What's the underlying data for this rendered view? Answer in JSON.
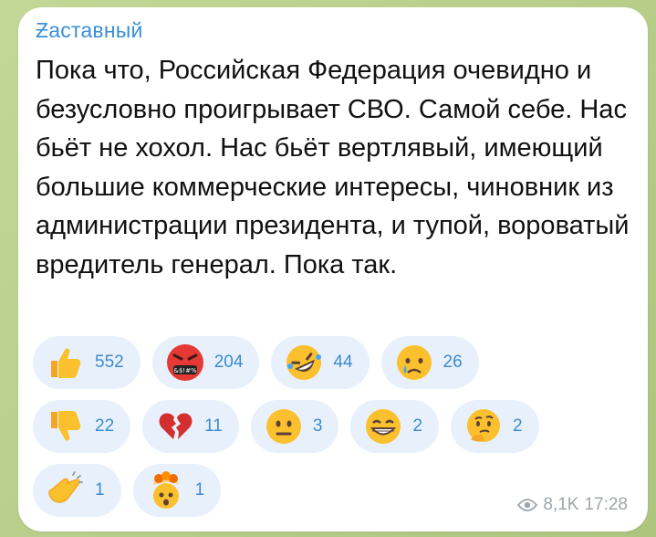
{
  "post": {
    "author": "Ƶаставный",
    "text": "Пока что, Российская Федерация очевидно и безусловно проигрывает СВО. Самой себе. Нас бьёт не хохол. Нас бьёт вертлявый, имеющий большие коммерческие интересы, чиновник из администрации президента, и тупой, вороватый вредитель генерал. Пока так.",
    "views": "8,1K",
    "time": "17:28"
  },
  "reactions": [
    {
      "icon": "thumbs-up-icon",
      "count": "552"
    },
    {
      "icon": "angry-face-cursing-icon",
      "count": "204"
    },
    {
      "icon": "rolling-laughing-icon",
      "count": "44"
    },
    {
      "icon": "crying-face-icon",
      "count": "26"
    },
    {
      "icon": "thumbs-down-icon",
      "count": "22"
    },
    {
      "icon": "broken-heart-icon",
      "count": "11"
    },
    {
      "icon": "neutral-face-icon",
      "count": "3"
    },
    {
      "icon": "grinning-face-icon",
      "count": "2"
    },
    {
      "icon": "thinking-face-icon",
      "count": "2"
    },
    {
      "icon": "clapping-hands-icon",
      "count": "1"
    },
    {
      "icon": "exploding-head-icon",
      "count": "1"
    }
  ],
  "colors": {
    "author": "#3a8fd6",
    "reaction_bg": "#e8f1fb",
    "reaction_text": "#3b8ad1",
    "meta_text": "#a0a5ab",
    "wallpaper": "#b9cf8e"
  }
}
